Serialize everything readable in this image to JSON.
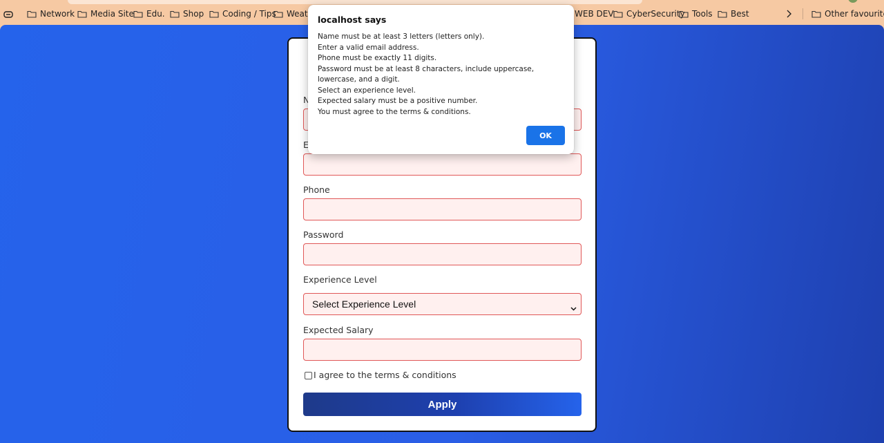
{
  "bookmarks": {
    "items": [
      {
        "label": "Network"
      },
      {
        "label": "Media Site"
      },
      {
        "label": "Edu."
      },
      {
        "label": "Shop"
      },
      {
        "label": "Coding / Tips"
      },
      {
        "label": "Weath"
      },
      {
        "label": "WEB DEV"
      },
      {
        "label": "CyberSecurity"
      },
      {
        "label": "Tools"
      },
      {
        "label": "Best"
      }
    ],
    "other_label": "Other favourites"
  },
  "form": {
    "fields": [
      {
        "label": "N"
      },
      {
        "label": "E"
      },
      {
        "label": "Phone"
      },
      {
        "label": "Password"
      },
      {
        "label": "Experience Level"
      },
      {
        "label": "Expected Salary"
      }
    ],
    "experience_select_value": "Select Experience Level",
    "agree_label": "I agree to the terms & conditions",
    "agree_checked": false,
    "apply_label": "Apply"
  },
  "alert": {
    "title": "localhost says",
    "lines": [
      "Name must be at least 3 letters (letters only).",
      "Enter a valid email address.",
      "Phone must be exactly 11 digits.",
      "Password must be at least 8 characters, include uppercase, lowercase, and a digit.",
      "Select an experience level.",
      "Expected salary must be a positive number.",
      "You must agree to the terms & conditions."
    ],
    "ok_label": "OK"
  },
  "colors": {
    "bookmarks_bg": "#f6c9a3",
    "page_blue": "#2563eb",
    "input_error_border": "#e05757",
    "input_error_bg": "#fff0ef",
    "ok_button": "#1a73e8"
  },
  "icons": {
    "tabs": "tab-actions-icon",
    "folder": "folder-icon",
    "more": "chevron-right-icon",
    "select": "chevron-down-icon"
  }
}
